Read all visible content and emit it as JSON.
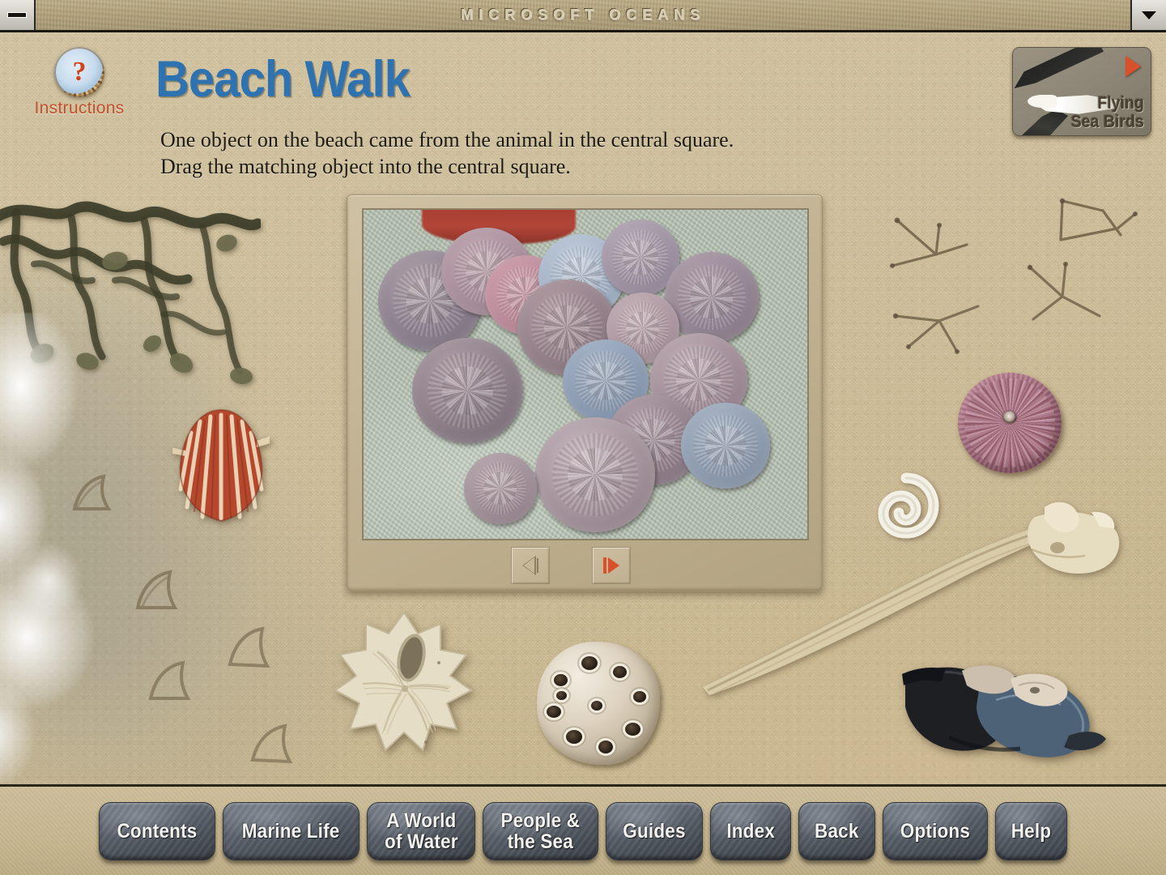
{
  "window": {
    "title": "MICROSOFT OCEANS",
    "minimize_icon": "minimize-icon",
    "dropdown_icon": "chevron-down-icon"
  },
  "header": {
    "instructions_label": "Instructions",
    "instructions_icon": "question-mark-badge-icon",
    "page_title": "Beach Walk",
    "instruction_line_1": "One object on the beach came from the animal in the central square.",
    "instruction_line_2": "Drag the matching object into the central square."
  },
  "feature_button": {
    "line_1": "Flying",
    "line_2": "Sea Birds",
    "play_icon": "play-triangle-icon",
    "bird_icon": "albatross-icon",
    "accent_color": "#d9512a"
  },
  "central_frame": {
    "photo_subject": "sand-dollars-on-gravel",
    "prev_label": "previous",
    "next_label": "next",
    "prev_icon": "previous-arrow-icon",
    "next_icon": "next-arrow-icon",
    "next_color": "#d9512a"
  },
  "beach_objects": [
    {
      "name": "seaweed",
      "label": "bladder wrack seaweed"
    },
    {
      "name": "sea-foam",
      "label": "sea foam"
    },
    {
      "name": "scallop-shell",
      "label": "red scallop shell"
    },
    {
      "name": "webbed-footprints",
      "label": "webbed bird footprints"
    },
    {
      "name": "bird-tracks",
      "label": "wading bird tracks"
    },
    {
      "name": "sea-urchin",
      "label": "purple sea urchin test"
    },
    {
      "name": "spiral-shell",
      "label": "white spiral worm shell"
    },
    {
      "name": "bone-driftwood",
      "label": "bleached bone and driftwood"
    },
    {
      "name": "keyhole-sand-dollar",
      "label": "keyhole sand dollar"
    },
    {
      "name": "barnacle-cluster",
      "label": "barnacle cluster"
    },
    {
      "name": "mussel-shells",
      "label": "blue mussel shells"
    }
  ],
  "nav": {
    "buttons": [
      {
        "id": "contents",
        "label": "Contents"
      },
      {
        "id": "marine-life",
        "label": "Marine Life"
      },
      {
        "id": "a-world-of-water",
        "label": "A World\nof Water"
      },
      {
        "id": "people-and-the-sea",
        "label": "People &\nthe Sea"
      },
      {
        "id": "guides",
        "label": "Guides"
      },
      {
        "id": "index",
        "label": "Index"
      },
      {
        "id": "back",
        "label": "Back"
      },
      {
        "id": "options",
        "label": "Options"
      },
      {
        "id": "help",
        "label": "Help"
      }
    ]
  },
  "colors": {
    "sand": "#d2c3a0",
    "title_blue": "#2e73b0",
    "instructions_red": "#c1502c",
    "button_slate": "#5d646e"
  }
}
